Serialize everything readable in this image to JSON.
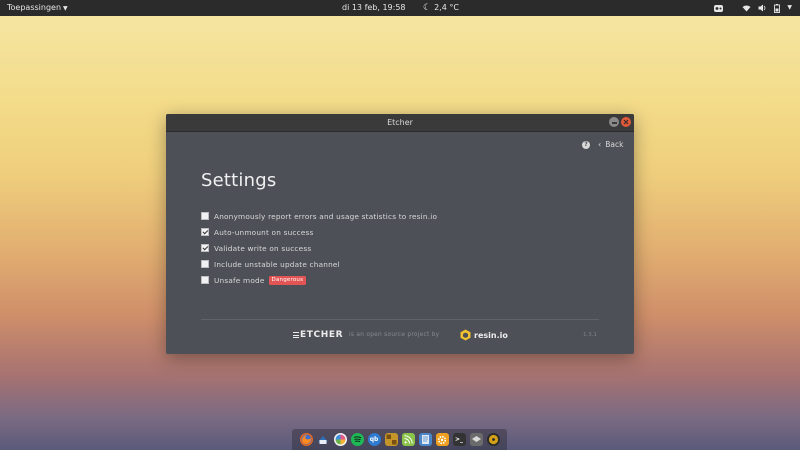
{
  "top_bar": {
    "apps_menu_label": "Toepassingen",
    "clock": "di 13 feb, 19:58",
    "weather": "2,4 °C",
    "tray_icons": [
      "podcast-icon",
      "wifi-icon",
      "volume-icon",
      "battery-icon",
      "power-icon"
    ]
  },
  "window": {
    "title": "Etcher",
    "header": {
      "help_icon": "help-icon",
      "back_label": "Back"
    },
    "page_title": "Settings",
    "settings": [
      {
        "label": "Anonymously report errors and usage statistics to resin.io",
        "checked": false
      },
      {
        "label": "Auto-unmount on success",
        "checked": true
      },
      {
        "label": "Validate write on success",
        "checked": true
      },
      {
        "label": "Include unstable update channel",
        "checked": false
      },
      {
        "label": "Unsafe mode",
        "checked": false,
        "badge": "Dangerous"
      }
    ],
    "footer": {
      "etcher_logo_text": "ETCHER",
      "tagline": "is an open source project by",
      "resin_logo_text": "resin.io",
      "version": "1.3.1"
    }
  },
  "dock": {
    "icons": [
      "firefox-icon",
      "thunderbird-icon",
      "pinwheel-icon",
      "spotify-icon",
      "qbittorrent-icon",
      "puzzle-icon",
      "feed-icon",
      "files-icon",
      "etcher-gear-icon",
      "terminal-icon",
      "dropbox-icon",
      "rhythmbox-icon"
    ],
    "colors": [
      "#e8671f",
      "#2f6fb5",
      "#e55a8a",
      "#1db954",
      "#2e7bd1",
      "#c4962a",
      "#8bc34a",
      "#4a86c8",
      "#f0a020",
      "#333333",
      "#6b6b6b",
      "#d4a017"
    ]
  },
  "colors": {
    "window_bg": "#4d5057",
    "titlebar_bg": "#3a3a3a",
    "close_button": "#e05a3a",
    "badge_red": "#e35555",
    "resin_yellow": "#f2c12e"
  }
}
